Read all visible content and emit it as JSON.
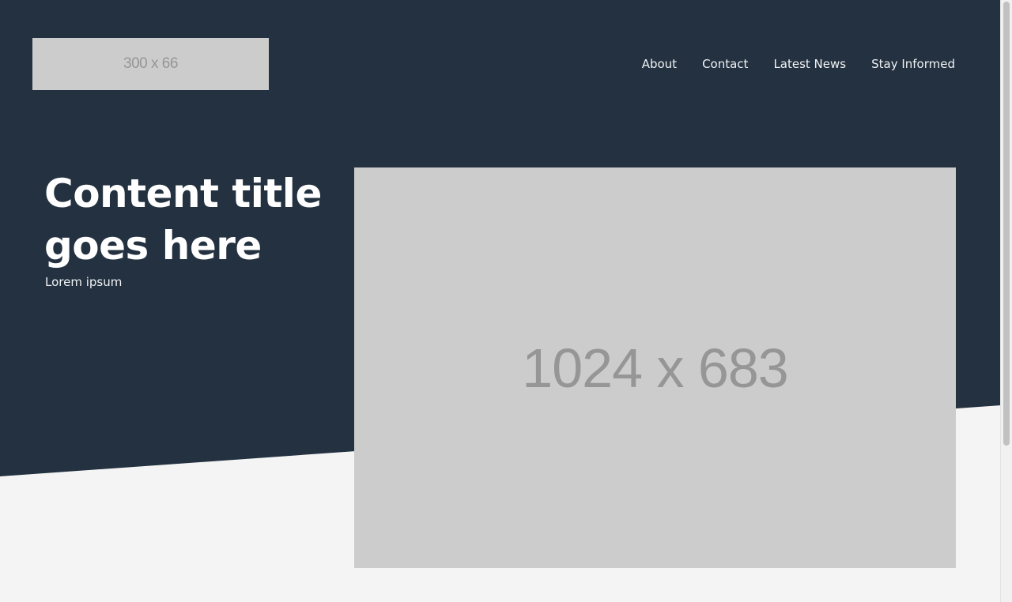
{
  "header": {
    "logo_text": "300 x 66",
    "nav": [
      {
        "label": "About"
      },
      {
        "label": "Contact"
      },
      {
        "label": "Latest News"
      },
      {
        "label": "Stay Informed"
      }
    ]
  },
  "hero": {
    "title": "Content title goes here",
    "subtitle": "Lorem ipsum",
    "image_text": "1024 x 683"
  },
  "colors": {
    "hero_background": "#233140",
    "page_background": "#f4f4f4",
    "placeholder": "#cccccc",
    "placeholder_text": "#969696",
    "text_light": "#ffffff"
  }
}
